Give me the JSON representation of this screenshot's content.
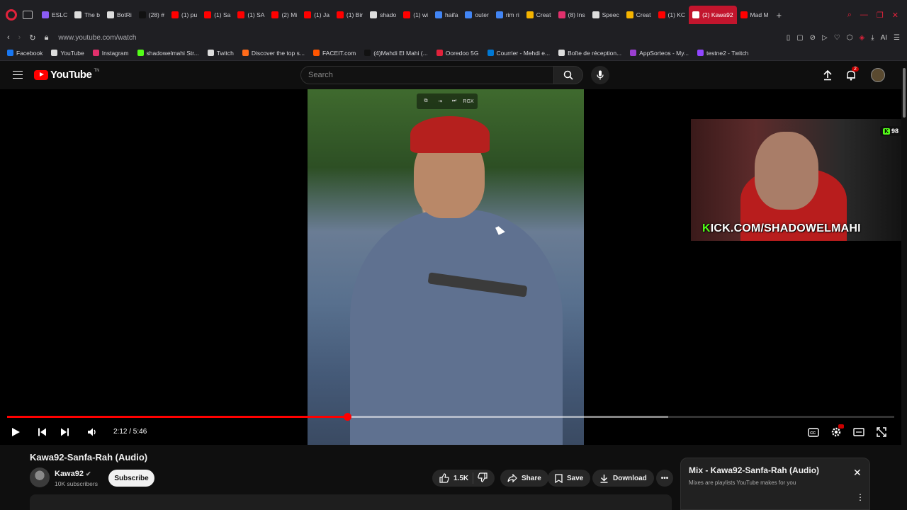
{
  "browser": {
    "tabs": [
      {
        "label": "ESLC",
        "color": "#8b5cf6"
      },
      {
        "label": "The b",
        "color": "#dddddd"
      },
      {
        "label": "BotRi",
        "color": "#dddddd"
      },
      {
        "label": "(28) #",
        "color": "#111111"
      },
      {
        "label": "(1) pu",
        "color": "#ff0000"
      },
      {
        "label": "(1) Sa",
        "color": "#ff0000"
      },
      {
        "label": "(1) SA",
        "color": "#ff0000"
      },
      {
        "label": "(2) Mi",
        "color": "#ff0000"
      },
      {
        "label": "(1) Ja",
        "color": "#ff0000"
      },
      {
        "label": "(1) Bir",
        "color": "#ff0000"
      },
      {
        "label": "shado",
        "color": "#dddddd"
      },
      {
        "label": "(1) wi",
        "color": "#ff0000"
      },
      {
        "label": "haifa",
        "color": "#4285f4"
      },
      {
        "label": "outer",
        "color": "#4285f4"
      },
      {
        "label": "rim ri",
        "color": "#4285f4"
      },
      {
        "label": "Creat",
        "color": "#f5b400"
      },
      {
        "label": "(8) Ins",
        "color": "#e1306c"
      },
      {
        "label": "Speec",
        "color": "#dddddd"
      },
      {
        "label": "Creat",
        "color": "#f5b400"
      },
      {
        "label": "(1) KC",
        "color": "#ff0000"
      }
    ],
    "active_tab": "(2) Kawa92",
    "after_tab": "Mad M",
    "url": "www.youtube.com/watch",
    "addr_ai": "AI"
  },
  "bookmarks": [
    {
      "label": "Facebook",
      "color": "#1877f2"
    },
    {
      "label": "YouTube",
      "color": "#dddddd"
    },
    {
      "label": "Instagram",
      "color": "#e1306c"
    },
    {
      "label": "shadowelmahi Str...",
      "color": "#53fc18"
    },
    {
      "label": "Twitch",
      "color": "#dddddd"
    },
    {
      "label": "Discover the top s...",
      "color": "#ff6b1a"
    },
    {
      "label": "FACEIT.com",
      "color": "#ff5500"
    },
    {
      "label": "(4)Mahdi El Mahi (...",
      "color": "#111111"
    },
    {
      "label": "Ooredoo 5G",
      "color": "#e0223b"
    },
    {
      "label": "Courrier - Mehdi e...",
      "color": "#0078d4"
    },
    {
      "label": "Boîte de réception...",
      "color": "#dddddd"
    },
    {
      "label": "AppSorteos - My...",
      "color": "#9b3fd1"
    },
    {
      "label": "testne2 - Twitch",
      "color": "#9146ff"
    }
  ],
  "youtube": {
    "logo_text": "YouTube",
    "logo_suffix": "TN",
    "search_placeholder": "Search",
    "notif_count": "2"
  },
  "player": {
    "time_text": "2:12 / 5:46",
    "progress": 0.383,
    "buffered": 0.745,
    "overlay_tag": "RGX",
    "webcam_text_k": "K",
    "webcam_text": "ICK.COM/SHADOWELMAHI",
    "viewer_count": "98",
    "kick_badge": "K"
  },
  "video": {
    "title": "Kawa92-Sanfa-Rah (Audio)",
    "channel": "Kawa92",
    "subscribers": "10K subscribers",
    "subscribe_label": "Subscribe",
    "likes": "1.5K",
    "share_label": "Share",
    "save_label": "Save",
    "download_label": "Download"
  },
  "mix": {
    "title": "Mix - Kawa92-Sanfa-Rah (Audio)",
    "subtitle": "Mixes are playlists YouTube makes for you"
  }
}
